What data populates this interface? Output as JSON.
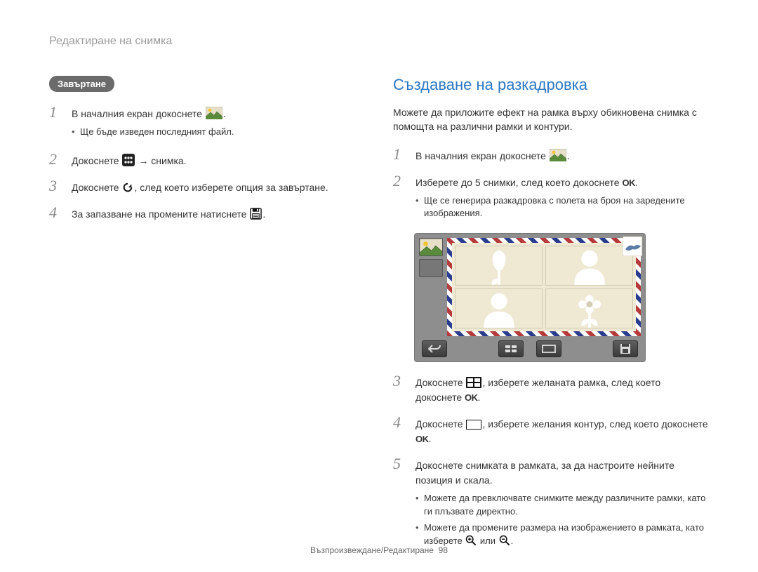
{
  "header": "Редактиране на снимка",
  "left": {
    "pill": "Завъртане",
    "steps": [
      {
        "num": "1",
        "segments": [
          {
            "t": "В началния екран докоснете "
          },
          {
            "icon": "landscape-thumb-icon"
          },
          {
            "t": "."
          }
        ],
        "notes": [
          "Ще бъде изведен последният файл."
        ]
      },
      {
        "num": "2",
        "segments": [
          {
            "t": "Докоснете "
          },
          {
            "icon": "edit-menu-icon"
          },
          {
            "t": " → снимка."
          }
        ]
      },
      {
        "num": "3",
        "segments": [
          {
            "t": "Докоснете "
          },
          {
            "icon": "rotate-icon"
          },
          {
            "t": ", след което изберете опция за завъртане."
          }
        ]
      },
      {
        "num": "4",
        "segments": [
          {
            "t": "За запазване на промените натиснете "
          },
          {
            "icon": "save-icon"
          },
          {
            "t": "."
          }
        ]
      }
    ]
  },
  "right": {
    "title": "Създаване на разкадровка",
    "intro": "Можете да приложите ефект на рамка върху обикновена снимка с помощта на различни рамки и контури.",
    "steps": [
      {
        "num": "1",
        "segments": [
          {
            "t": "В началния екран докоснете "
          },
          {
            "icon": "landscape-thumb-icon"
          },
          {
            "t": "."
          }
        ]
      },
      {
        "num": "2",
        "segments": [
          {
            "t": "Изберете до 5 снимки, след което докоснете "
          },
          {
            "ok": true
          },
          {
            "t": "."
          }
        ],
        "notes": [
          "Ще се генерира разкадровка с полета на броя на заредените изображения."
        ],
        "image": true
      },
      {
        "num": "3",
        "segments": [
          {
            "t": "Докоснете "
          },
          {
            "icon": "frame-picker-icon"
          },
          {
            "t": ", изберете желаната рамка, след което докоснете "
          },
          {
            "ok": true
          },
          {
            "t": "."
          }
        ]
      },
      {
        "num": "4",
        "segments": [
          {
            "t": "Докоснете "
          },
          {
            "icon": "outline-picker-icon"
          },
          {
            "t": ", изберете желания контур, след което докоснете "
          },
          {
            "ok": true
          },
          {
            "t": "."
          }
        ]
      },
      {
        "num": "5",
        "segments": [
          {
            "t": "Докоснете снимката в рамката, за да настроите нейните позиция и скала."
          }
        ],
        "notes": [
          "Можете да превключвате снимките между различните рамки, като ги плъзвате директно.",
          {
            "segments": [
              {
                "t": "Можете да промените размера на изображението в рамката, като изберете "
              },
              {
                "icon": "zoom-in-icon"
              },
              {
                "t": " или "
              },
              {
                "icon": "zoom-out-icon"
              },
              {
                "t": "."
              }
            ]
          }
        ]
      }
    ]
  },
  "footer": {
    "label": "Възпроизвеждане/Редактиране",
    "page": "98"
  },
  "ok_label": "OK"
}
